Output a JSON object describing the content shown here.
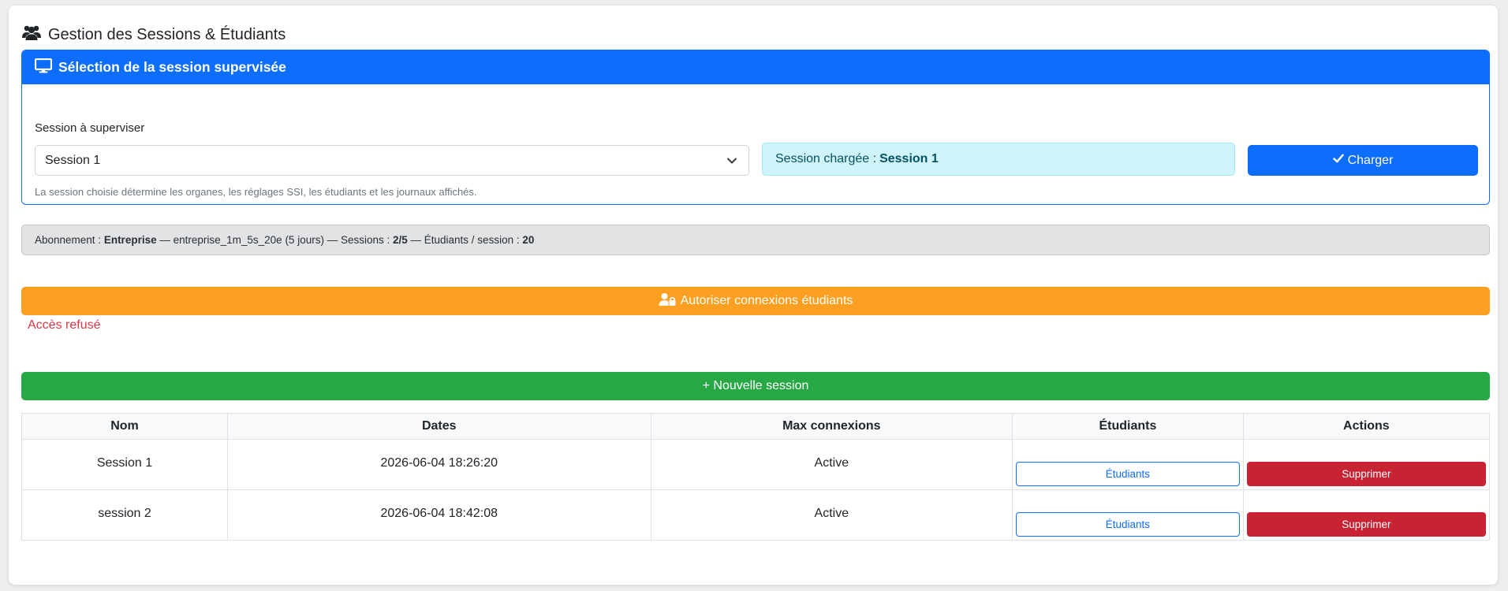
{
  "page": {
    "title": "Gestion des Sessions & Étudiants",
    "title_icon": "users-icon"
  },
  "session_card": {
    "header": "Sélection de la session supervisée",
    "header_icon": "monitor-icon",
    "field_label": "Session à superviser",
    "selected_session": "Session 1",
    "help_text": "La session choisie détermine les organes, les réglages SSI, les étudiants et les journaux affichés.",
    "loaded_prefix": "Session chargée :",
    "loaded_value": "Session 1",
    "load_button": "Charger"
  },
  "subscription": {
    "label": "Abonnement : ",
    "plan": "Entreprise",
    "middle": " — entreprise_1m_5s_20e (5 jours) — Sessions : ",
    "sessions": "2/5",
    "students_label": " — Étudiants / session : ",
    "students_per_session": "20"
  },
  "allow_button": "Autoriser connexions étudiants",
  "allow_error": "Accès refusé",
  "new_session_button": "+ Nouvelle session",
  "table": {
    "headers": [
      "Nom",
      "Dates",
      "Max connexions",
      "Étudiants",
      "Actions"
    ],
    "rows": [
      {
        "name": "Session 1",
        "date": "2026-06-04 18:26:20",
        "max": "Active",
        "students_btn": "Étudiants",
        "delete_btn": "Supprimer"
      },
      {
        "name": "session 2",
        "date": "2026-06-04 18:42:08",
        "max": "Active",
        "students_btn": "Étudiants",
        "delete_btn": "Supprimer"
      }
    ]
  },
  "colors": {
    "primary": "#0d6efd",
    "warning": "#fd9f20",
    "success": "#28a745",
    "danger": "#c82333",
    "info_bg": "#cff4fc"
  }
}
